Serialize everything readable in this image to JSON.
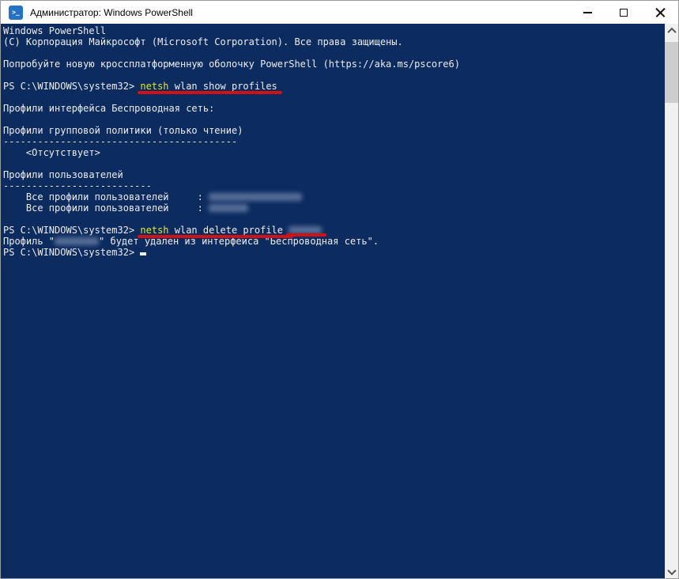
{
  "window": {
    "title": "Администратор: Windows PowerShell",
    "app_icon_glyph": ">_",
    "controls": {
      "minimize": "minimize-icon",
      "maximize": "maximize-icon",
      "close": "close-icon"
    }
  },
  "colors": {
    "terminal_bg": "#0c2b5f",
    "terminal_text": "#eeedf0",
    "command_highlight_yellow": "#e5e532",
    "annotation_red_underline": "#d01212",
    "titlebar_bg": "#ffffff",
    "app_icon_blue": "#2572c4",
    "scrollbar_track": "#f0f0f0",
    "scrollbar_thumb": "#cdcdcd"
  },
  "icons": [
    "powershell-icon",
    "minimize-icon",
    "maximize-icon",
    "close-icon",
    "chevron-up-icon",
    "chevron-down-icon"
  ],
  "terminal": {
    "lines": [
      {
        "segments": [
          {
            "t": "Windows PowerShell"
          }
        ]
      },
      {
        "segments": [
          {
            "t": "(C) Корпорация Майкрософт (Microsoft Corporation). Все права защищены."
          }
        ]
      },
      {
        "segments": []
      },
      {
        "segments": [
          {
            "t": "Попробуйте новую кроссплатформенную оболочку PowerShell (https://aka.ms/pscore6)"
          }
        ]
      },
      {
        "segments": []
      },
      {
        "segments": [
          {
            "t": "PS C:\\WINDOWS\\system32> ",
            "name": "prompt"
          },
          {
            "t": "netsh",
            "style": "cmd",
            "u": true,
            "name": "command-netsh"
          },
          {
            "t": " wlan show profiles",
            "u": true,
            "name": "command-args"
          }
        ]
      },
      {
        "segments": []
      },
      {
        "segments": [
          {
            "t": "Профили интерфейса Беспроводная сеть:"
          }
        ]
      },
      {
        "segments": []
      },
      {
        "segments": [
          {
            "t": "Профили групповой политики (только чтение)"
          }
        ]
      },
      {
        "segments": [
          {
            "t": "-----------------------------------------"
          }
        ]
      },
      {
        "segments": [
          {
            "t": "    <Отсутствует>"
          }
        ]
      },
      {
        "segments": []
      },
      {
        "segments": [
          {
            "t": "Профили пользователей"
          }
        ]
      },
      {
        "segments": [
          {
            "t": "--------------------------"
          }
        ]
      },
      {
        "segments": [
          {
            "t": "    Все профили пользователей     : "
          },
          {
            "blur": 118,
            "name": "redacted-profile-name-1"
          }
        ]
      },
      {
        "segments": [
          {
            "t": "    Все профили пользователей     : "
          },
          {
            "blur": 50,
            "name": "redacted-profile-name-2"
          }
        ]
      },
      {
        "segments": []
      },
      {
        "segments": [
          {
            "t": "PS C:\\WINDOWS\\system32> ",
            "name": "prompt"
          },
          {
            "t": "netsh",
            "style": "cmd",
            "u": true,
            "name": "command-netsh"
          },
          {
            "t": " wlan delete profile ",
            "u": true,
            "name": "command-args"
          },
          {
            "blur": 42,
            "u": true,
            "name": "redacted-profile-name-3"
          }
        ]
      },
      {
        "segments": [
          {
            "t": "Профиль \""
          },
          {
            "blur": 56,
            "name": "redacted-profile-name-4"
          },
          {
            "t": "\" будет удален из интерфейса \"Беспроводная сеть\"."
          }
        ]
      },
      {
        "segments": [
          {
            "t": "PS C:\\WINDOWS\\system32> ",
            "name": "prompt"
          },
          {
            "cursor": true
          }
        ]
      }
    ]
  }
}
